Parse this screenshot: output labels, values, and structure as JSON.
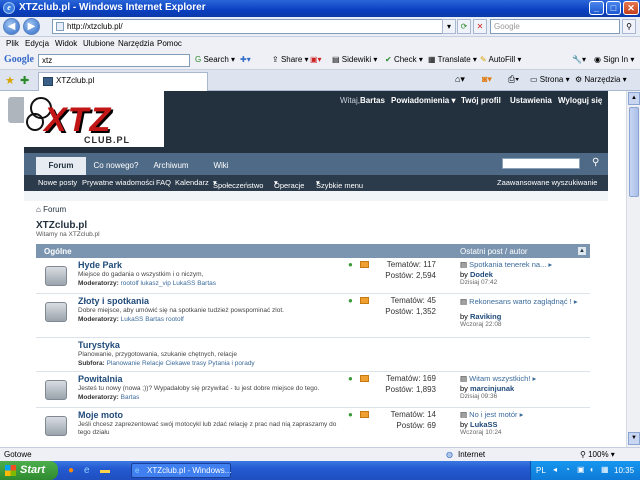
{
  "window": {
    "title": "XTZclub.pl - Windows Internet Explorer"
  },
  "address": {
    "url": "http://xtzclub.pl/",
    "search_placeholder": "Google"
  },
  "menu": [
    "Plik",
    "Edycja",
    "Widok",
    "Ulubione",
    "Narzędzia",
    "Pomoc"
  ],
  "google_bar": {
    "logo": "Google",
    "query": "xtz",
    "items": [
      "Search",
      "Share",
      "Sidewiki",
      "Check",
      "Translate",
      "AutoFill",
      "Sign In"
    ]
  },
  "tab": {
    "label": "XTZclub.pl",
    "tools": [
      "Strona",
      "Narzędzia"
    ]
  },
  "forum": {
    "logo_text": "XTZ",
    "logo_sub": "CLUB.PL",
    "top_links": {
      "welcome": "Witaj,",
      "user": "Bartas",
      "notifications": "Powiadomienia",
      "profile": "Twój profil",
      "settings": "Ustawienia",
      "logout": "Wyloguj się"
    },
    "tabs": [
      "Forum",
      "Co nowego?",
      "Archiwum",
      "Wiki"
    ],
    "subnav": [
      "Nowe posty",
      "Prywatne wiadomości",
      "FAQ",
      "Kalendarz",
      "Społeczeństwo",
      "Operacje",
      "Szybkie menu"
    ],
    "advanced_search": "Zaawansowane wyszukiwanie",
    "breadcrumb": "Forum",
    "title": "XTZclub.pl",
    "subtitle": "Witamy na XTZclub.pl",
    "category": "Ogólne",
    "last_post_header": "Ostatni post / autor",
    "rows": [
      {
        "name": "Hyde Park",
        "desc": "Miejsce do gadania o wszystkim i o niczym,",
        "mod_label": "Moderatorzy:",
        "mods": "rootolf lukasz_vip LukaSS Bartas",
        "topics": "Tematów: 117",
        "posts": "Postów: 2,594",
        "lp_title": "Spotkania tenerek na...",
        "lp_by": "by",
        "lp_author": "Dodek",
        "lp_date": "Dzisiaj 07:42"
      },
      {
        "name": "Złoty i spotkania",
        "desc": "Dobre miejsce, aby umówić się na spotkanie tudzież powspominać zlot.",
        "mod_label": "Moderatorzy:",
        "mods": "LukaSS Bartas rootolf",
        "topics": "Tematów: 45",
        "posts": "Postów: 1,352",
        "lp_title": "Rekonesans warto zaglądnąć !",
        "lp_by": "by",
        "lp_author": "Raviking",
        "lp_date": "Wczoraj 22:08"
      },
      {
        "name": "Turystyka",
        "desc": "Planowanie, przygotowania, szukanie chętnych, relacje",
        "mod_label": "Subfora:",
        "mods": "Planowanie  Relacje  Ciekawe trasy  Pytania i porady",
        "topics": "",
        "posts": "",
        "lp_title": "",
        "lp_by": "",
        "lp_author": "",
        "lp_date": ""
      },
      {
        "name": "Powitalnia",
        "desc": "Jesteś tu nowy (nowa ;))? Wypadałoby się przywitać - tu jest dobre miejsce do tego.",
        "mod_label": "Moderatorzy:",
        "mods": "Bartas",
        "topics": "Tematów: 169",
        "posts": "Postów: 1,893",
        "lp_title": "Witam wszystkich!",
        "lp_by": "by",
        "lp_author": "marcinjunak",
        "lp_date": "Dzisiaj 09:36"
      },
      {
        "name": "Moje moto",
        "desc": "Jeśli chcesz zaprezentować swój motocykl lub zdać relację z prac nad nią zapraszamy do tego działu",
        "mod_label": "",
        "mods": "",
        "topics": "Tematów: 14",
        "posts": "Postów: 69",
        "lp_title": "No i jest motór",
        "lp_by": "by",
        "lp_author": "LukaSS",
        "lp_date": "Wczoraj 10:24"
      }
    ]
  },
  "status": {
    "left": "Gotowe",
    "zone": "Internet",
    "zoom": "100%"
  },
  "taskbar": {
    "start": "Start",
    "task": "XTZclub.pl - Windows...",
    "lang": "PL",
    "clock": "10:35"
  }
}
